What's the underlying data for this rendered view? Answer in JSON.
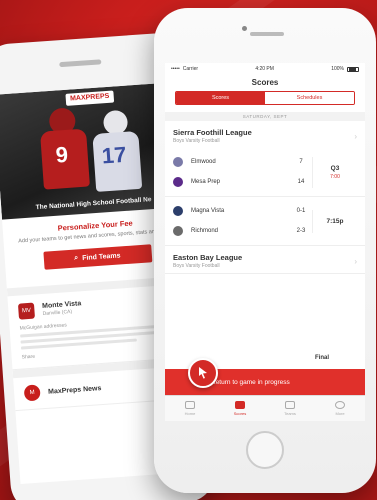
{
  "back_phone": {
    "hero": {
      "brand": "MAXPREPS",
      "caption": "The National High School Football Ne",
      "jersey_red": "9",
      "jersey_blue": "17"
    },
    "personalize": {
      "title": "Personalize Your Fee",
      "description": "Add your teams to get news and scores, sports, stats and more."
    },
    "find_button_label": "Find Teams",
    "feed": [
      {
        "title": "Monte Vista",
        "subtitle": "Danville (CA)",
        "body_title": "McGuigan addresses",
        "footer": "Share",
        "logo": "MV"
      },
      {
        "title": "MaxPreps News",
        "logo": "M"
      }
    ]
  },
  "front_phone": {
    "status": {
      "carrier": "Carrier",
      "time": "4:20 PM",
      "battery": "100%"
    },
    "nav_title": "Scores",
    "tabs": [
      {
        "label": "Scores",
        "active": true
      },
      {
        "label": "Schedules",
        "active": false
      }
    ],
    "date_label": "SATURDAY, SEPT",
    "leagues": [
      {
        "name": "Sierra Foothill League",
        "subtitle": "Boys Varsity Football",
        "games": [
          {
            "teams": [
              {
                "name": "Elmwood",
                "score": "7",
                "logo_color": "#7a7aa8"
              },
              {
                "name": "Mesa Prep",
                "score": "14",
                "logo_color": "#5b2b8a"
              }
            ],
            "status": "Q3",
            "status_sub": "7:00"
          },
          {
            "teams": [
              {
                "name": "Magna Vista",
                "score": "0-1",
                "logo_color": "#2c3e6b"
              },
              {
                "name": "Richmond",
                "score": "2-3",
                "logo_color": "#6b6b6b"
              }
            ],
            "status": "7:15p",
            "status_sub": ""
          }
        ]
      },
      {
        "name": "Easton Bay League",
        "subtitle": "Boys Varsity Football",
        "games": []
      }
    ],
    "final_label": "Final",
    "return_text": "Return to game in progress",
    "tabbar": [
      {
        "label": "Home",
        "active": false
      },
      {
        "label": "Scores",
        "active": true
      },
      {
        "label": "Teams",
        "active": false
      },
      {
        "label": "More",
        "active": false
      }
    ]
  }
}
